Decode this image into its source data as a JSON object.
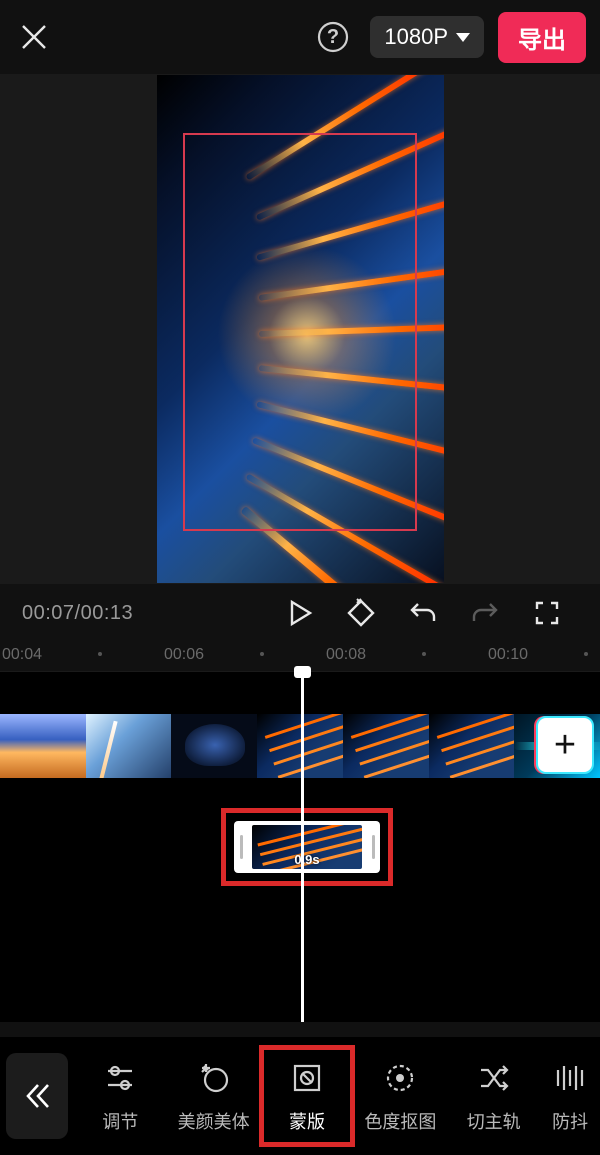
{
  "header": {
    "resolution_label": "1080P",
    "export_label": "导出"
  },
  "playbar": {
    "timecode": "00:07/00:13"
  },
  "ruler": {
    "t0": "00:04",
    "t1": "00:06",
    "t2": "00:08",
    "t3": "00:10"
  },
  "clip": {
    "duration_label": "0.9s"
  },
  "toolbar": {
    "items": {
      "adjust": "调节",
      "beauty": "美颜美体",
      "mask": "蒙版",
      "chroma": "色度抠图",
      "mainTrack": "切主轨",
      "stabilize": "防抖"
    }
  }
}
